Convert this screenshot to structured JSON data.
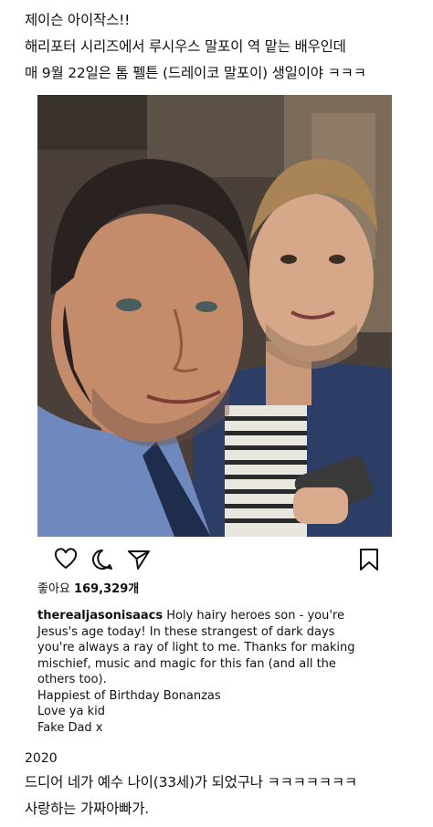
{
  "intro": {
    "lines": [
      "제이슨 아이작스!!",
      "해리포터 시리즈에서 루시우스 말포이 역 맡는 배우인데",
      "매 9월 22일은 톰 펠튼 (드레이코 말포이) 생일이야 ㅋㅋㅋ"
    ]
  },
  "post": {
    "photo_alt": "Selfie of Jason Isaacs and Tom Felton",
    "icons": {
      "like": "heart-icon",
      "comment": "comment-bubble-icon",
      "share": "paper-plane-icon",
      "save": "bookmark-icon"
    },
    "likes_label": "좋아요",
    "likes_count": "169,329개",
    "username": "therealjasonisaacs",
    "caption_lines": [
      "Holy hairy heroes son - you're",
      "Jesus's age today! In these strangest of dark days",
      "you're always a ray of light to me. Thanks for making",
      "mischief, music and magic for this fan (and all the",
      "others too).",
      "Happiest of Birthday Bonanzas",
      "Love ya kid",
      "Fake Dad x"
    ]
  },
  "outro": {
    "year": "2020",
    "lines": [
      "드디어 네가 예수 나이(33세)가 되었구나 ㅋㅋㅋㅋㅋㅋㅋ",
      "사랑하는 가짜아빠가."
    ]
  }
}
